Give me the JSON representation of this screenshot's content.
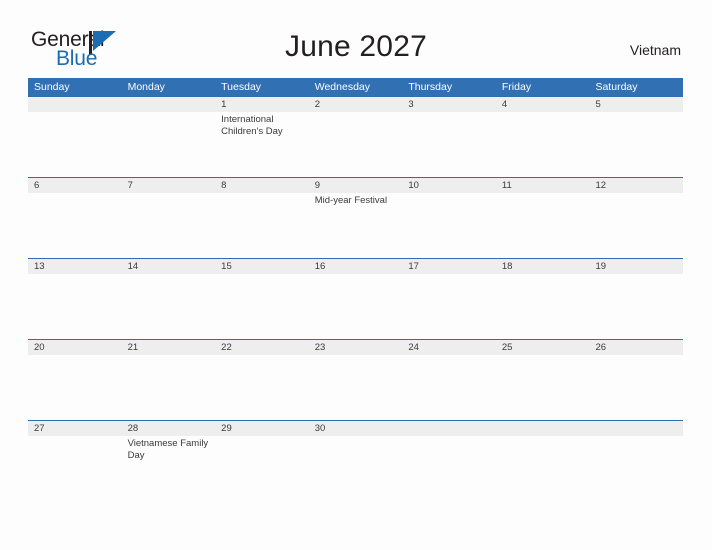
{
  "brand": {
    "name_top": "General",
    "name_bottom": "Blue",
    "mark_icon": "triangle-flag-icon",
    "accent_color": "#1b6cb0",
    "text_color": "#231f20"
  },
  "header": {
    "title": "June 2027",
    "country": "Vietnam",
    "header_blue": "#3070b3",
    "row_line_color": "#2e6daf",
    "daynum_band_color": "#eeeeee"
  },
  "weekdays": [
    "Sunday",
    "Monday",
    "Tuesday",
    "Wednesday",
    "Thursday",
    "Friday",
    "Saturday"
  ],
  "weeks": [
    [
      {
        "day": "",
        "event": ""
      },
      {
        "day": "",
        "event": ""
      },
      {
        "day": "1",
        "event": "International Children's Day"
      },
      {
        "day": "2",
        "event": ""
      },
      {
        "day": "3",
        "event": ""
      },
      {
        "day": "4",
        "event": ""
      },
      {
        "day": "5",
        "event": ""
      }
    ],
    [
      {
        "day": "6",
        "event": ""
      },
      {
        "day": "7",
        "event": ""
      },
      {
        "day": "8",
        "event": ""
      },
      {
        "day": "9",
        "event": "Mid-year Festival"
      },
      {
        "day": "10",
        "event": ""
      },
      {
        "day": "11",
        "event": ""
      },
      {
        "day": "12",
        "event": ""
      }
    ],
    [
      {
        "day": "13",
        "event": ""
      },
      {
        "day": "14",
        "event": ""
      },
      {
        "day": "15",
        "event": ""
      },
      {
        "day": "16",
        "event": ""
      },
      {
        "day": "17",
        "event": ""
      },
      {
        "day": "18",
        "event": ""
      },
      {
        "day": "19",
        "event": ""
      }
    ],
    [
      {
        "day": "20",
        "event": ""
      },
      {
        "day": "21",
        "event": ""
      },
      {
        "day": "22",
        "event": ""
      },
      {
        "day": "23",
        "event": ""
      },
      {
        "day": "24",
        "event": ""
      },
      {
        "day": "25",
        "event": ""
      },
      {
        "day": "26",
        "event": ""
      }
    ],
    [
      {
        "day": "27",
        "event": ""
      },
      {
        "day": "28",
        "event": "Vietnamese Family Day"
      },
      {
        "day": "29",
        "event": ""
      },
      {
        "day": "30",
        "event": ""
      },
      {
        "day": "",
        "event": ""
      },
      {
        "day": "",
        "event": ""
      },
      {
        "day": "",
        "event": ""
      }
    ]
  ]
}
